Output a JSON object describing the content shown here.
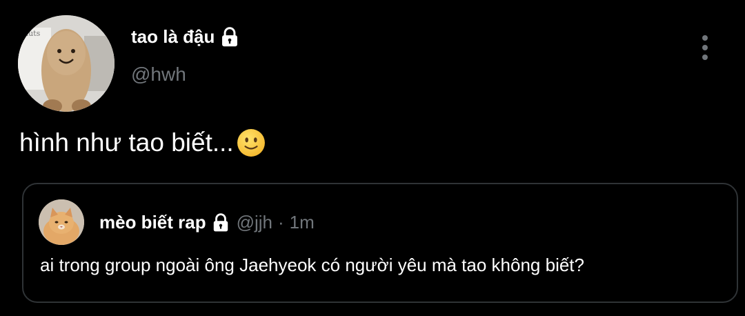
{
  "post": {
    "author": {
      "display_name": "tao là đậu",
      "handle": "@hwh",
      "avatar_icon": "peanut-plush-avatar",
      "avatar_text": "nuts",
      "verified_icon": "lock-icon"
    },
    "text": "hình như tao biết...",
    "emoji": "slightly-smiling-face-icon",
    "menu_icon": "more-options-icon"
  },
  "quote": {
    "author": {
      "display_name": "mèo biết rap",
      "handle": "@jjh",
      "avatar_icon": "cat-avatar",
      "lock_icon": "lock-icon"
    },
    "separator": "·",
    "time": "1m",
    "text": "ai trong group ngoài ông Jaehyeok có người yêu mà tao không biết?"
  },
  "colors": {
    "background": "#000000",
    "primary_text": "#ffffff",
    "secondary_text": "#71767b",
    "border": "#2f3336"
  }
}
